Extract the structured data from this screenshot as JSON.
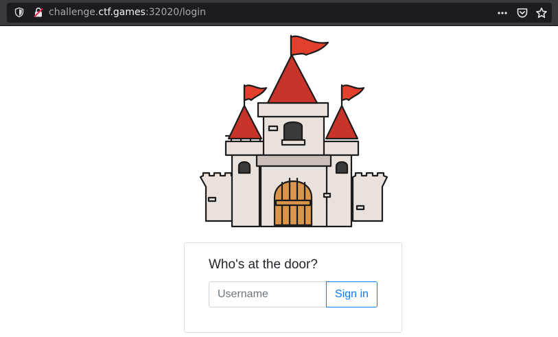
{
  "browser": {
    "url_prefix": "challenge.",
    "url_host": "ctf.games",
    "url_suffix": ":32020/login",
    "icons": [
      "shield-icon",
      "lock-insecure-icon",
      "more-icon",
      "pocket-icon",
      "star-icon"
    ]
  },
  "hero": {
    "image": "castle-illustration",
    "colors": {
      "roof": "#c9342a",
      "flag": "#e2402c",
      "wall": "#e8e1dc",
      "door": "#d9954a",
      "outline": "#1b1b1b"
    }
  },
  "login": {
    "title": "Who's at the door?",
    "username_placeholder": "Username",
    "username_value": "",
    "signin_label": "Sign in"
  },
  "colors": {
    "accent": "#007bff",
    "toolbar_bg": "#38383d",
    "urlbar_bg": "#1c1b22"
  }
}
